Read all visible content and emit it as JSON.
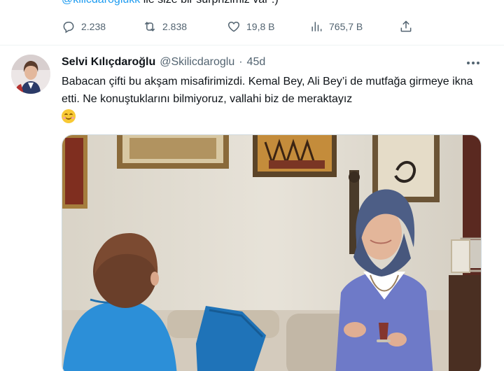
{
  "previous_tweet": {
    "mention": "@kilicdaroglukk",
    "text_rest": " ile size bir sürprizimiz var :)",
    "stats": {
      "replies": "2.238",
      "retweets": "2.838",
      "likes": "19,8 B",
      "views": "765,7 B"
    }
  },
  "tweet": {
    "author_name": "Selvi Kılıçdaroğlu",
    "handle": "@Skilicdaroglu",
    "separator": "·",
    "time": "45d",
    "text": "Babacan çifti bu akşam misafirimizdi. Kemal Bey, Ali Bey’i de mutfağa girmeye ikna etti. Ne konuştuklarını bilmiyoruz, vallahi biz de meraktayız",
    "emoji": "smiling-face-with-smiling-eyes"
  },
  "colors": {
    "accent": "#1d9bf0",
    "secondary_text": "#536471",
    "primary_text": "#0f1419"
  }
}
